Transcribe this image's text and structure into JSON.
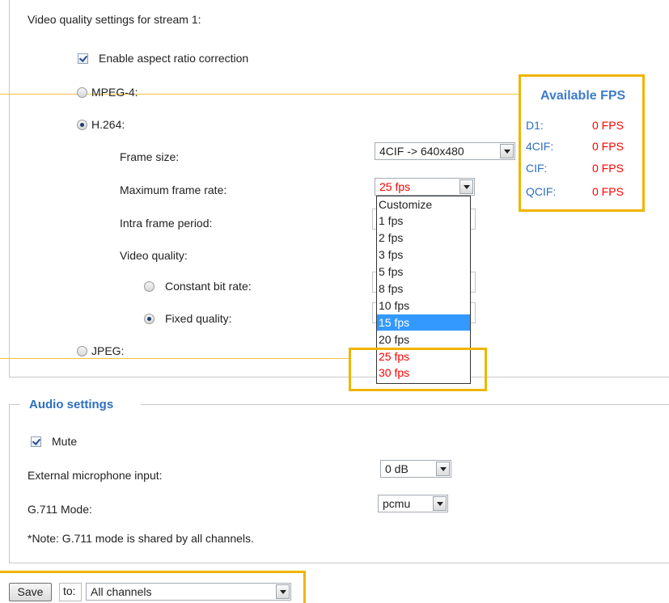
{
  "video": {
    "heading": "Video quality settings for stream 1:",
    "aspect_label": "Enable aspect ratio correction",
    "mpeg4_label": "MPEG-4:",
    "h264_label": "H.264:",
    "frame_size_label": "Frame size:",
    "frame_size_value": "4CIF -> 640x480",
    "max_frame_rate_label": "Maximum frame rate:",
    "max_frame_rate_value": "25 fps",
    "intra_label": "Intra frame period:",
    "video_quality_label": "Video quality:",
    "cbr_label": "Constant bit rate:",
    "fixed_label": "Fixed quality:",
    "jpeg_label": "JPEG:",
    "frame_rate_options": [
      "Customize",
      "1 fps",
      "2 fps",
      "3 fps",
      "5 fps",
      "8 fps",
      "10 fps",
      "15 fps",
      "20 fps",
      "25 fps",
      "30 fps"
    ],
    "highlighted_option": "15 fps"
  },
  "available_fps": {
    "title": "Available FPS",
    "rows": [
      {
        "label": "D1:",
        "value": "0 FPS"
      },
      {
        "label": "4CIF:",
        "value": "0 FPS"
      },
      {
        "label": "CIF:",
        "value": "0 FPS"
      },
      {
        "label": "QCIF:",
        "value": "0 FPS"
      }
    ]
  },
  "audio": {
    "title": "Audio settings",
    "mute_label": "Mute",
    "ext_mic_label": "External microphone input:",
    "ext_mic_value": "0 dB",
    "g711_label": "G.711 Mode:",
    "g711_value": "pcmu",
    "note": "*Note: G.711 mode is shared by all channels."
  },
  "footer": {
    "save_label": "Save",
    "to_label": "to:",
    "channels_value": "All channels"
  },
  "colors": {
    "accent_blue": "#2d6fc0",
    "red": "#ff0000",
    "highlight": "#3399ff",
    "callout_orange": "#f0b400"
  }
}
